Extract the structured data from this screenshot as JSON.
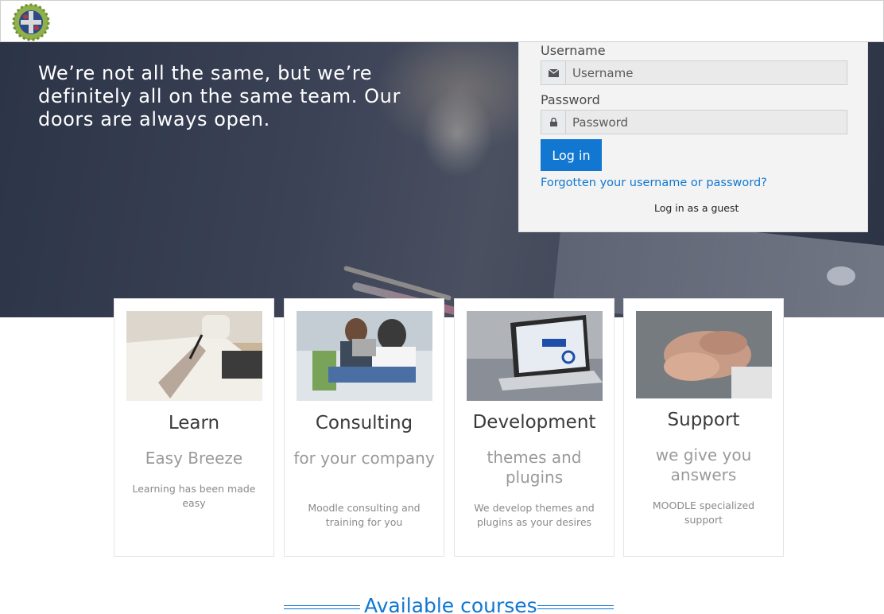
{
  "header": {
    "logo_name": "site-logo"
  },
  "hero": {
    "heading": "We’re not all the same, but we’re definitely all on the same team. Our doors are always open."
  },
  "login": {
    "username_label": "Username",
    "username_placeholder": "Username",
    "password_label": "Password",
    "password_placeholder": "Password",
    "login_button": "Log in",
    "forgot_link": "Forgotten your username or password?",
    "guest_link": "Log in as a guest"
  },
  "features": [
    {
      "title": "Learn",
      "subtitle": "Easy Breeze",
      "description": "Learning has been made easy"
    },
    {
      "title": "Consulting",
      "subtitle": "for your company",
      "description": "Moodle consulting and training for you"
    },
    {
      "title": "Development",
      "subtitle": "themes and plugins",
      "description": "We develop themes and plugins as your desires"
    },
    {
      "title": "Support",
      "subtitle": "we give you answers",
      "description": "MOODLE specialized support"
    }
  ],
  "courses": {
    "heading": "Available courses"
  },
  "colors": {
    "accent": "#1177d1",
    "hero_bg": "#3b4256"
  }
}
